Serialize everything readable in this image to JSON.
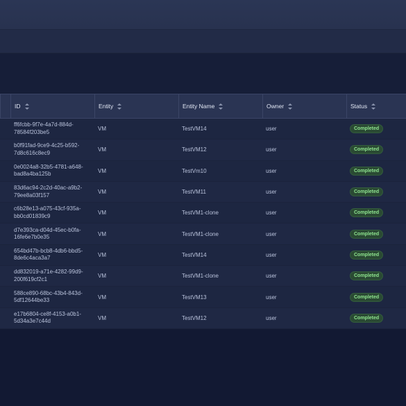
{
  "table": {
    "headers": {
      "id": "ID",
      "entity": "Entity",
      "entity_name": "Entity Name",
      "owner": "Owner",
      "status": "Status"
    },
    "rows": [
      {
        "id": "ff6fcbb-9f7e-4a7d-884d-78584f203be5",
        "entity": "VM",
        "entity_name": "TestVM14",
        "owner": "user",
        "status": "Completed"
      },
      {
        "id": "b0f91fad-9ce9-4c25-b592-7d8c616c8ec9",
        "entity": "VM",
        "entity_name": "TestVM12",
        "owner": "user",
        "status": "Completed"
      },
      {
        "id": "0e0024a8-32b5-4781-a648-bad8a4ba125b",
        "entity": "VM",
        "entity_name": "TestVm10",
        "owner": "user",
        "status": "Completed"
      },
      {
        "id": "83d6ac94-2c2d-40ac-a9b2-79ee8a03f157",
        "entity": "VM",
        "entity_name": "TestVM11",
        "owner": "user",
        "status": "Completed"
      },
      {
        "id": "c6b28e13-a075-43cf-935a-bb0cd01839c9",
        "entity": "VM",
        "entity_name": "TestVM1-clone",
        "owner": "user",
        "status": "Completed"
      },
      {
        "id": "d7e393ca-d04d-45ec-b0fa-16fe6e7b0e35",
        "entity": "VM",
        "entity_name": "TestVM1-clone",
        "owner": "user",
        "status": "Completed"
      },
      {
        "id": "654bd47b-bcb8-4db6-bbd5-8de6c4aca3a7",
        "entity": "VM",
        "entity_name": "TestVM14",
        "owner": "user",
        "status": "Completed"
      },
      {
        "id": "dd832019-a71e-4282-99d9-200f619cf2c1",
        "entity": "VM",
        "entity_name": "TestVM1-clone",
        "owner": "user",
        "status": "Completed"
      },
      {
        "id": "588ce890-68bc-43b4-843d-5df12644be33",
        "entity": "VM",
        "entity_name": "TestVM13",
        "owner": "user",
        "status": "Completed"
      },
      {
        "id": "e17b6804-ce8f-4153-a0b1-5d34a3e7c44d",
        "entity": "VM",
        "entity_name": "TestVM12",
        "owner": "user",
        "status": "Completed"
      }
    ]
  },
  "colors": {
    "status_completed_text": "#8ee38f",
    "status_completed_bg": "#2a4a33"
  }
}
